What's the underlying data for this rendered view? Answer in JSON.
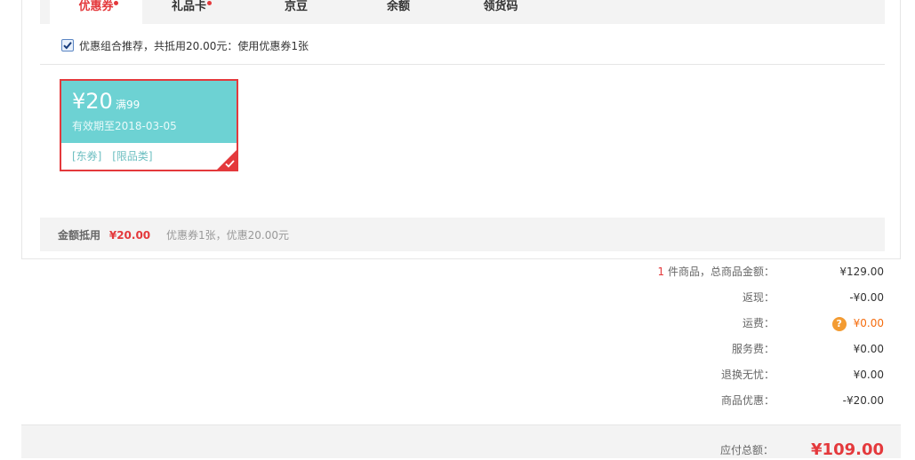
{
  "tabs": [
    {
      "label": "优惠券"
    },
    {
      "label": "礼品卡"
    },
    {
      "label": "京豆"
    },
    {
      "label": "余额"
    },
    {
      "label": "领货码"
    }
  ],
  "combo": {
    "checked": true,
    "text": "优惠组合推荐，共抵用20.00元：使用优惠券1张"
  },
  "coupon": {
    "amount": "¥20",
    "condition": "满99",
    "validity": "有效期至2018-03-05",
    "tags": [
      "[东券]",
      "[限品类]"
    ]
  },
  "summary": {
    "label": "金额抵用",
    "amount": "¥20.00",
    "detail": "优惠券1张，优惠20.00元"
  },
  "order": {
    "item_count": "1",
    "items_label": " 件商品，总商品金额：",
    "items_total": "¥129.00",
    "cashback_label": "返现：",
    "cashback_value": "-¥0.00",
    "shipping_label": "运费：",
    "shipping_value": "¥0.00",
    "service_label": "服务费：",
    "service_value": "¥0.00",
    "return_label": "退换无忧：",
    "return_value": "¥0.00",
    "discount_label": "商品优惠：",
    "discount_value": "-¥20.00",
    "payable_label": "应付总额：",
    "payable_value": "¥109.00"
  },
  "colors": {
    "accent": "#e4393c",
    "coupon_bg": "#6dd2d3",
    "shipping": "#f56c0e"
  }
}
